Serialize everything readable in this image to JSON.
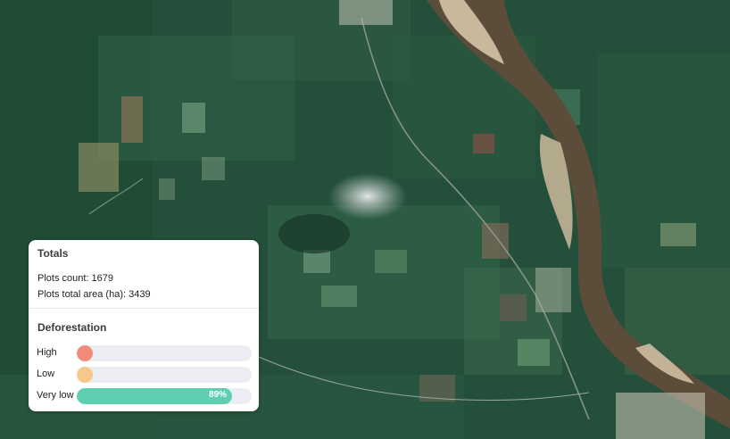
{
  "totals": {
    "title": "Totals",
    "plots_count": "Plots count: 1679",
    "plots_area": "Plots total area (ha): 3439"
  },
  "deforestation": {
    "title": "Deforestation",
    "levels": [
      {
        "label": "High",
        "fraction": 0.01,
        "color": "#f28b7b",
        "percent_label": ""
      },
      {
        "label": "Low",
        "fraction": 0.05,
        "color": "#f6c98a",
        "percent_label": ""
      },
      {
        "label": "Very low",
        "fraction": 0.89,
        "color": "#5ecfb3",
        "percent_label": "89%"
      }
    ]
  },
  "colors": {
    "forest": "#23503c",
    "river": "#5c4d3a",
    "sandbar": "#d6c4a8",
    "panel_bg": "#ffffff"
  }
}
